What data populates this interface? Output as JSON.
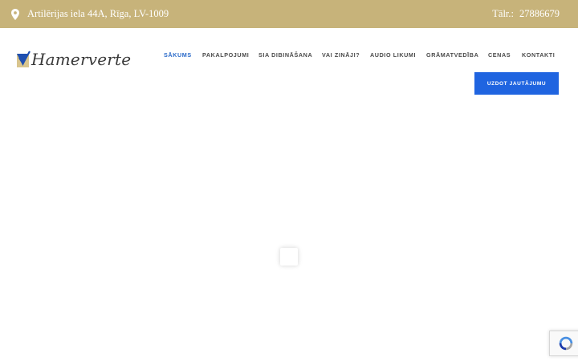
{
  "topbar": {
    "address": "Artilērijas iela 44A, Rīga, LV-1009",
    "phone_label": "Tālr.:",
    "phone_number": "27886679",
    "background_color": "#c7b37a",
    "icon": "map-pin-icon"
  },
  "logo": {
    "text": "Hamerverte",
    "icon": "checkmark-shield-icon"
  },
  "nav": {
    "items": [
      {
        "label": "SĀKUMS",
        "active": true
      },
      {
        "label": "PAKALPOJUMI",
        "active": false
      },
      {
        "label": "SIA DIBINĀŠANA",
        "active": false
      },
      {
        "label": "VAI ZINĀJI?",
        "active": false
      },
      {
        "label": "AUDIO LIKUMI",
        "active": false
      },
      {
        "label": "GRĀMATVEDĪBA",
        "active": false
      },
      {
        "label": "CENAS",
        "active": false
      },
      {
        "label": "KONTAKTI",
        "active": false
      }
    ],
    "active_color": "#2a6ac9"
  },
  "cta": {
    "label": "UZDOT JAUTĀJUMU",
    "color": "#1f64e0"
  },
  "recaptcha": {
    "icon": "recaptcha-icon"
  }
}
